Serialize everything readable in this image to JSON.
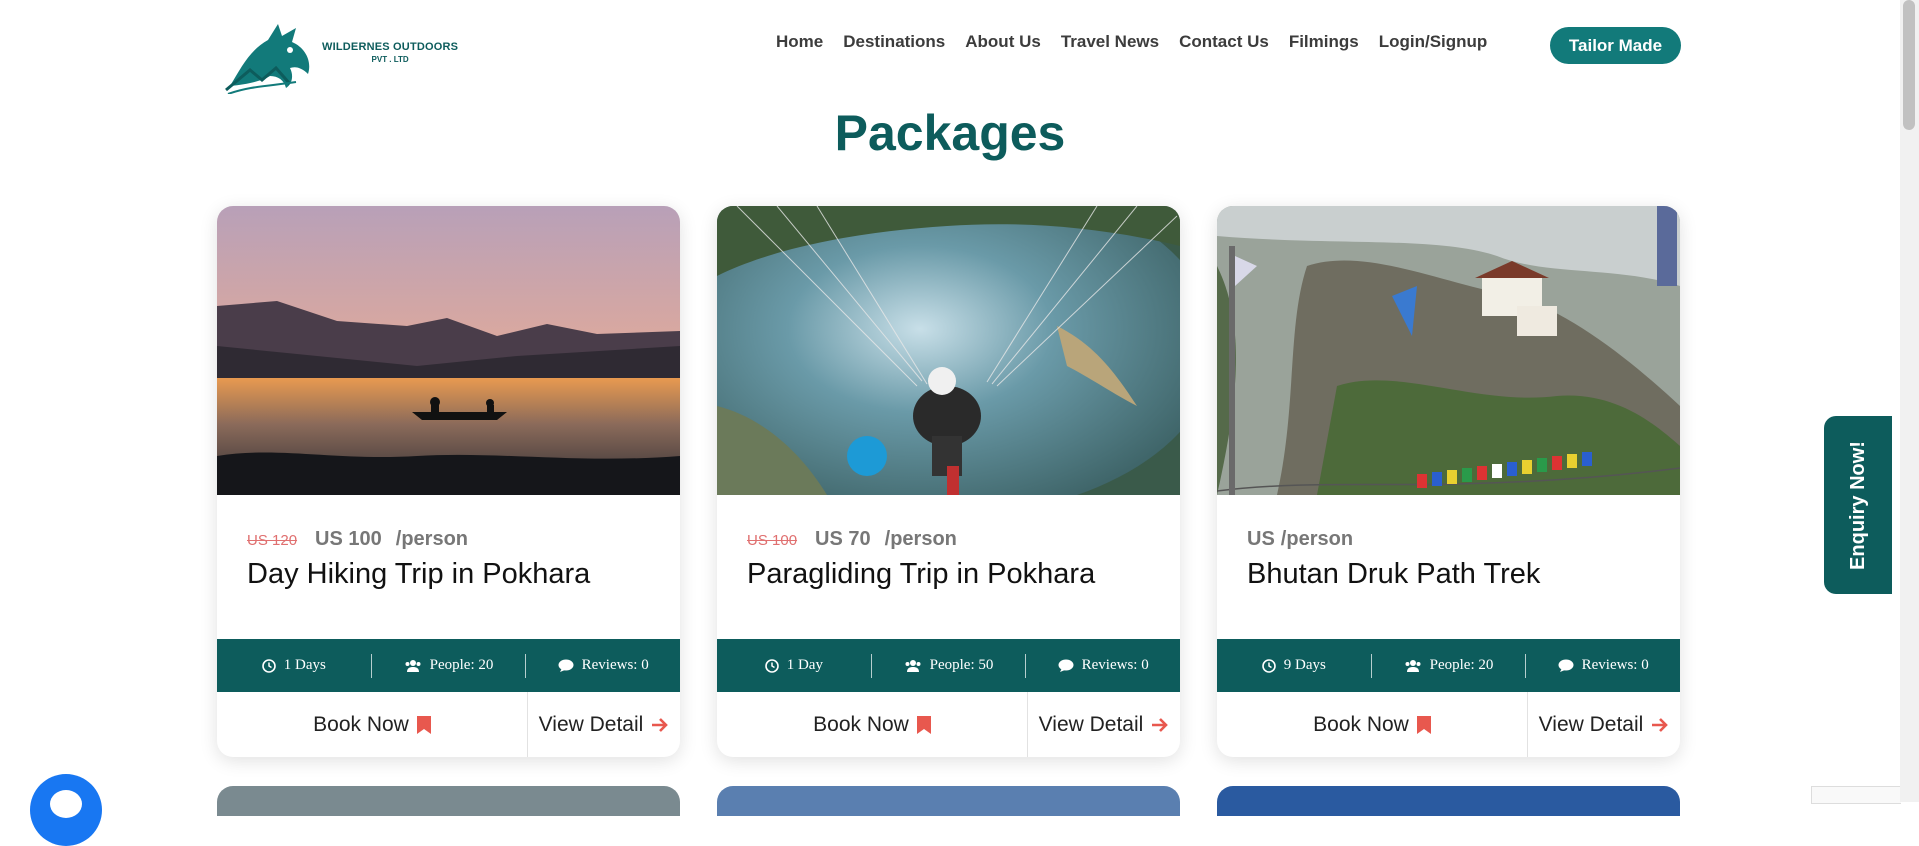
{
  "header": {
    "logo_line1": "WILDERNES OUTDOORS",
    "logo_line2": "PVT . LTD",
    "nav": [
      "Home",
      "Destinations",
      "About Us",
      "Travel News",
      "Contact Us",
      "Filmings",
      "Login/Signup"
    ],
    "cta": "Tailor Made"
  },
  "page_title": "Packages",
  "packages": [
    {
      "old_price": "US 120",
      "price": "US 100",
      "per": "/person",
      "title": "Day Hiking Trip in Pokhara",
      "duration": "1 Days",
      "people": "People: 20",
      "reviews": "Reviews: 0",
      "book": "Book Now",
      "view": "View Detail"
    },
    {
      "old_price": "US 100",
      "price": "US 70",
      "per": "/person",
      "title": "Paragliding Trip in Pokhara",
      "duration": "1 Day",
      "people": "People: 50",
      "reviews": "Reviews: 0",
      "book": "Book Now",
      "view": "View Detail"
    },
    {
      "old_price": "",
      "price": "US",
      "per": "/person",
      "title": "Bhutan Druk Path Trek",
      "duration": "9 Days",
      "people": "People: 20",
      "reviews": "Reviews: 0",
      "book": "Book Now",
      "view": "View Detail"
    }
  ],
  "enquiry": "Enquiry Now!",
  "colors": {
    "brand": "#0d5c5c",
    "cta": "#127a7a",
    "accent": "#e8584e"
  }
}
